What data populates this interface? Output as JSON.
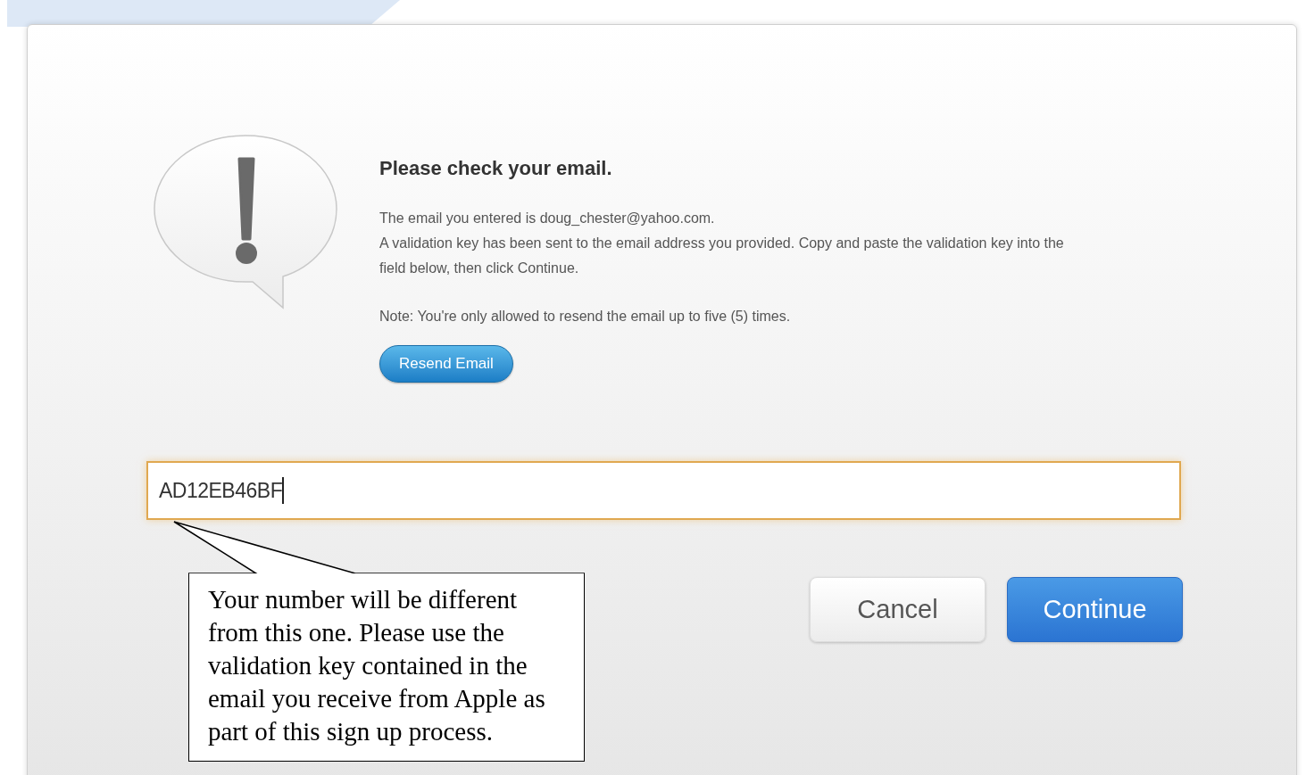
{
  "dialog": {
    "title": "Please check your email.",
    "body_lines": [
      "The email you entered is doug_chester@yahoo.com.",
      "A validation key has been sent to the email address you provided. Copy and paste the validation key into the field below, then click Continue."
    ],
    "note": "Note: You're only allowed to resend the email up to five (5) times.",
    "resend_button": "Resend Email",
    "key_field": {
      "value": "AD12EB46BF",
      "focused": true
    },
    "buttons": [
      {
        "label": "Cancel",
        "kind": "secondary"
      },
      {
        "label": "Continue",
        "kind": "primary"
      }
    ]
  },
  "callout": {
    "text": "Your number will be different from this one. Please use the validation key contained in the email you receive from Apple as part of this sign up process."
  }
}
